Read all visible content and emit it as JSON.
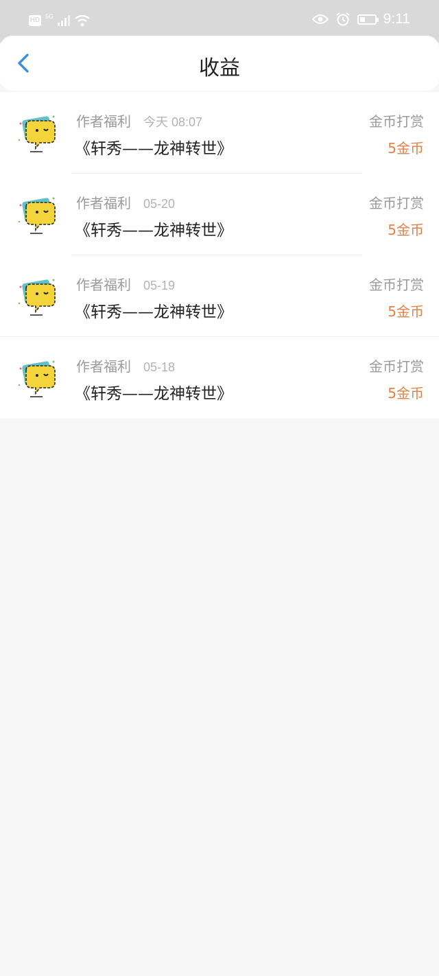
{
  "status_bar": {
    "hd": "HD",
    "network": "5G",
    "time": "9:11",
    "battery_level": 0.35
  },
  "header": {
    "title": "收益",
    "back_icon": "chevron-left-icon",
    "accent_color": "#3b8ee0"
  },
  "records": [
    {
      "category": "作者福利",
      "time": "今天 08:07",
      "book": "《轩秀——龙神转世》",
      "reward_type": "金币打赏",
      "amount": "5金币"
    },
    {
      "category": "作者福利",
      "time": "05-20",
      "book": "《轩秀——龙神转世》",
      "reward_type": "金币打赏",
      "amount": "5金币"
    },
    {
      "category": "作者福利",
      "time": "05-19",
      "book": "《轩秀——龙神转世》",
      "reward_type": "金币打赏",
      "amount": "5金币"
    },
    {
      "category": "作者福利",
      "time": "05-18",
      "book": "《轩秀——龙神转世》",
      "reward_type": "金币打赏",
      "amount": "5金币"
    }
  ],
  "colors": {
    "amount": "#e0834a",
    "avatar_bubble": "#f3d43a",
    "avatar_card": "#5fc0c8"
  }
}
